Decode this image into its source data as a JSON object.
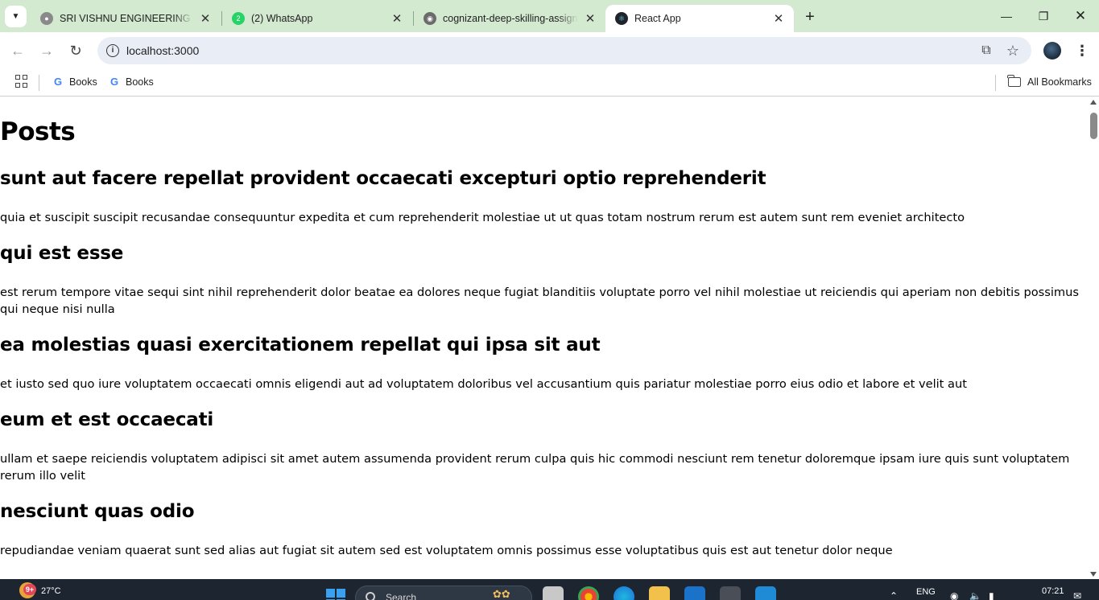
{
  "browser": {
    "tabs": [
      {
        "title": "SRI VISHNU ENGINEERING COLLEGE",
        "active": false,
        "favicon": "globe-icon"
      },
      {
        "title": "(2) WhatsApp",
        "active": false,
        "favicon": "whatsapp-icon"
      },
      {
        "title": "cognizant-deep-skilling-assignments",
        "active": false,
        "favicon": "github-icon"
      },
      {
        "title": "React App",
        "active": true,
        "favicon": "react-icon"
      }
    ],
    "address": "localhost:3000",
    "bookmarks": [
      {
        "label": "Books",
        "icon": "google-icon"
      },
      {
        "label": "Books",
        "icon": "google-icon"
      }
    ],
    "all_bookmarks_label": "All Bookmarks"
  },
  "page": {
    "heading": "Posts",
    "posts": [
      {
        "title": "sunt aut facere repellat provident occaecati excepturi optio reprehenderit",
        "body": "quia et suscipit suscipit recusandae consequuntur expedita et cum reprehenderit molestiae ut ut quas totam nostrum rerum est autem sunt rem eveniet architecto"
      },
      {
        "title": "qui est esse",
        "body": "est rerum tempore vitae sequi sint nihil reprehenderit dolor beatae ea dolores neque fugiat blanditiis voluptate porro vel nihil molestiae ut reiciendis qui aperiam non debitis possimus qui neque nisi nulla"
      },
      {
        "title": "ea molestias quasi exercitationem repellat qui ipsa sit aut",
        "body": "et iusto sed quo iure voluptatem occaecati omnis eligendi aut ad voluptatem doloribus vel accusantium quis pariatur molestiae porro eius odio et labore et velit aut"
      },
      {
        "title": "eum et est occaecati",
        "body": "ullam et saepe reiciendis voluptatem adipisci sit amet autem assumenda provident rerum culpa quis hic commodi nesciunt rem tenetur doloremque ipsam iure quis sunt voluptatem rerum illo velit"
      },
      {
        "title": "nesciunt quas odio",
        "body": "repudiandae veniam quaerat sunt sed alias aut fugiat sit autem sed est voluptatem omnis possimus esse voluptatibus quis est aut tenetur dolor neque"
      }
    ]
  },
  "taskbar": {
    "weather_badge": "9+",
    "temperature": "27°C",
    "search_placeholder": "Search",
    "language": "ENG",
    "time": "07:21"
  },
  "colors": {
    "tabstrip_bg": "#d3e9d0",
    "taskbar_bg": "#1c2530",
    "whatsapp_green": "#25d366",
    "react_blue": "#61dafb"
  }
}
